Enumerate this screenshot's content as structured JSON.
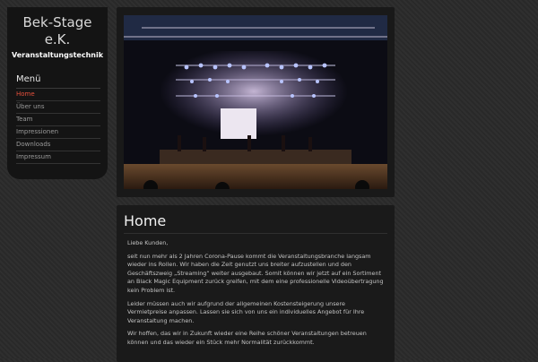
{
  "brand": {
    "name_line1": "Bek-Stage",
    "name_line2": "e.K.",
    "subtitle": "Veranstaltungstechnik"
  },
  "menu": {
    "title": "Menü",
    "items": [
      {
        "label": "Home",
        "active": true
      },
      {
        "label": "Über uns"
      },
      {
        "label": "Team"
      },
      {
        "label": "Impressionen"
      },
      {
        "label": "Downloads"
      },
      {
        "label": "Impressum"
      }
    ]
  },
  "main": {
    "title": "Home",
    "paragraphs": [
      "Liebe Kunden,",
      "seit nun mehr als 2 Jahren Corona-Pause kommt die Veranstaltungsbranche langsam wieder ins Rollen. Wir haben die Zeit genutzt uns breiter aufzustellen und den Geschäftszweig „Streaming“ weiter ausgebaut. Somit können wir jetzt auf ein Sortiment an Black Magic Equipment zurück greifen, mit dem eine professionelle Videoübertragung kein Problem ist.",
      "Leider müssen auch wir aufgrund der allgemeinen Kostensteigerung unsere Vermietpreise anpassen. Lassen sie sich von uns ein individuelles Angebot für Ihre Veranstaltung machen.",
      "Wir hoffen, das wir in Zukunft wieder eine Reihe schöner Veranstaltungen betreuen können und das wieder ein Stück mehr Normalität zurückkommt."
    ]
  },
  "colors": {
    "accent": "#e6503c",
    "background": "#2a2a2a",
    "panel": "#1a1a1a"
  }
}
